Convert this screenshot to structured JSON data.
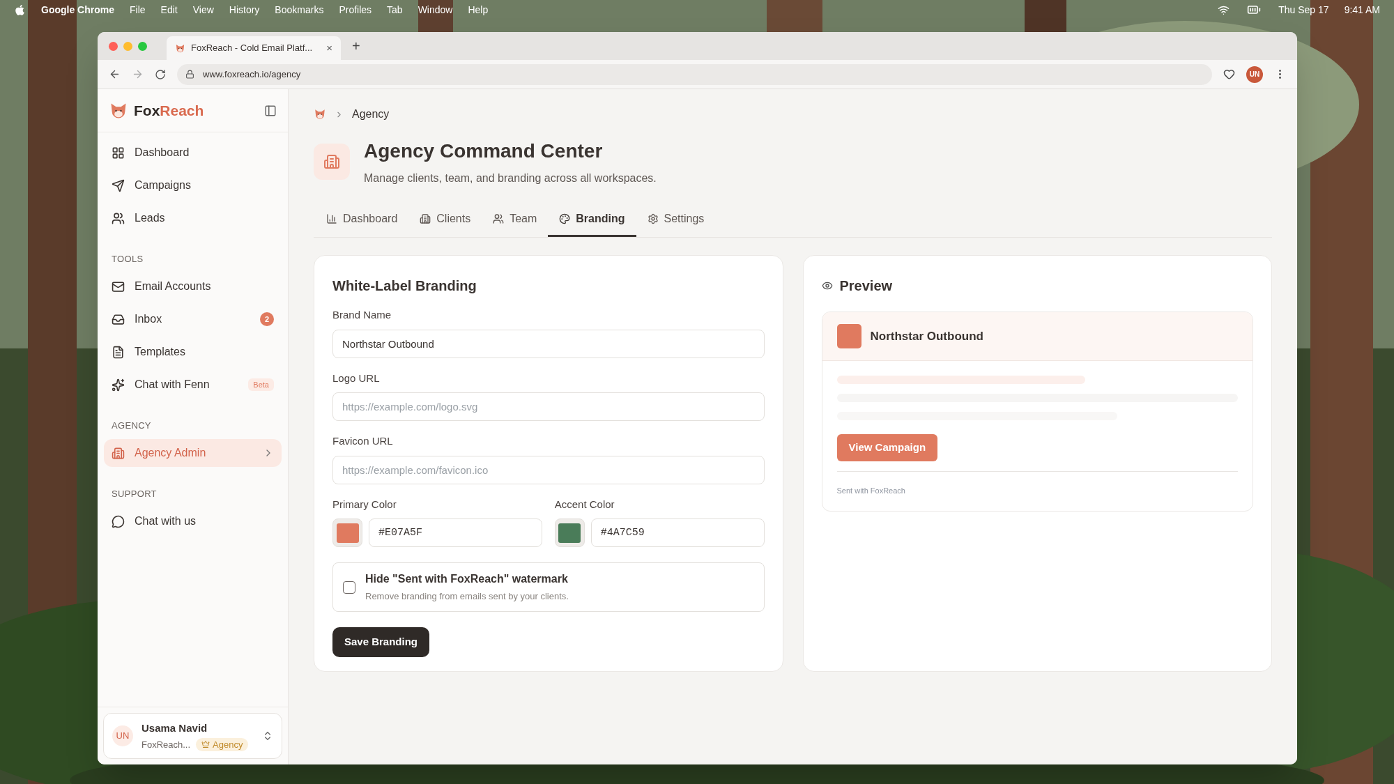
{
  "menubar": {
    "items": [
      "Google Chrome",
      "File",
      "Edit",
      "View",
      "History",
      "Bookmarks",
      "Profiles",
      "Tab",
      "Window",
      "Help"
    ],
    "date": "Thu Sep 17",
    "time": "9:41 AM"
  },
  "browser": {
    "tab_title": "FoxReach - Cold Email Platf...",
    "tab_close": "×",
    "new_tab": "+",
    "url": "www.foxreach.io/agency",
    "avatar": "UN"
  },
  "sidebar": {
    "brand_dark": "Fox",
    "brand_accent": "Reach",
    "sections": [
      {
        "items": [
          {
            "label": "Dashboard",
            "selected": false
          },
          {
            "label": "Campaigns",
            "selected": false
          },
          {
            "label": "Leads",
            "selected": false
          }
        ]
      },
      {
        "heading": "TOOLS",
        "items": [
          {
            "label": "Email Accounts",
            "selected": false
          },
          {
            "label": "Inbox",
            "selected": false,
            "badge": {
              "kind": "count",
              "text": "2"
            }
          },
          {
            "label": "Templates",
            "selected": false
          },
          {
            "label": "Chat with Fenn",
            "selected": false,
            "badge": {
              "kind": "tag",
              "text": "Beta"
            }
          }
        ]
      },
      {
        "heading": "AGENCY",
        "items": [
          {
            "label": "Agency Admin",
            "selected": true,
            "chevron": true
          }
        ]
      },
      {
        "heading": "SUPPORT",
        "items": [
          {
            "label": "Chat with us",
            "selected": false
          }
        ]
      }
    ],
    "user": {
      "initials": "UN",
      "name": "Usama Navid",
      "workspace": "FoxReach...",
      "plan": "Agency"
    }
  },
  "breadcrumb": {
    "current": "Agency"
  },
  "header": {
    "title": "Agency Command Center",
    "subtitle": "Manage clients, team, and branding across all workspaces."
  },
  "tabs": [
    {
      "label": "Dashboard",
      "selected": false
    },
    {
      "label": "Clients",
      "selected": false
    },
    {
      "label": "Team",
      "selected": false
    },
    {
      "label": "Branding",
      "selected": true
    },
    {
      "label": "Settings",
      "selected": false
    }
  ],
  "form": {
    "title": "White-Label Branding",
    "fields": [
      {
        "label": "Brand Name",
        "value": "Northstar Outbound"
      },
      {
        "label": "Logo URL",
        "placeholder": "https://example.com/logo.svg"
      },
      {
        "label": "Favicon URL",
        "placeholder": "https://example.com/favicon.ico"
      }
    ],
    "colors": [
      {
        "label": "Primary Color",
        "value": "#E07A5F"
      },
      {
        "label": "Accent Color",
        "value": "#4A7C59"
      }
    ],
    "watermark": {
      "label": "Hide \"Sent with FoxReach\" watermark",
      "hint": "Remove branding from emails sent by your clients.",
      "checked": false
    },
    "save": "Save Branding"
  },
  "preview": {
    "title": "Preview",
    "brand": "Northstar Outbound",
    "button": "View Campaign",
    "footer": "Sent with FoxReach"
  }
}
